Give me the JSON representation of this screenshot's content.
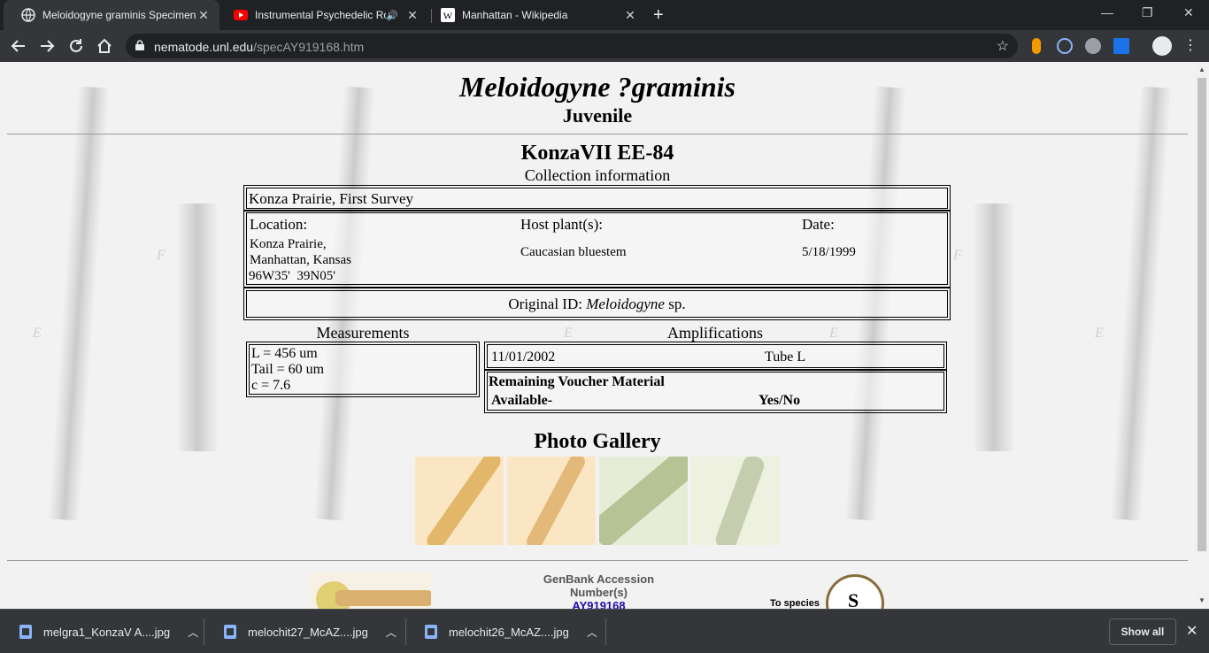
{
  "browser": {
    "tabs": [
      {
        "title": "Meloidogyne graminis Specimen",
        "active": true,
        "icon": "globe-icon"
      },
      {
        "title": "Instrumental Psychedelic Ro",
        "active": false,
        "icon": "youtube-icon",
        "audio": true
      },
      {
        "title": "Manhattan - Wikipedia",
        "active": false,
        "icon": "wikipedia-icon"
      }
    ],
    "new_tab": "+",
    "window_controls": [
      "—",
      "❐",
      "✕"
    ],
    "url_host": "nematode.unl.edu",
    "url_path": "/specAY919168.htm"
  },
  "page": {
    "species": "Meloidogyne ?graminis",
    "stage": "Juvenile",
    "specimen": "KonzaVII EE-84",
    "collection_heading": "Collection information",
    "survey": "Konza Prairie, First Survey",
    "location_label": "Location:",
    "location_lines": [
      "Konza Prairie,",
      "Manhattan, Kansas",
      "96W35'  39N05'"
    ],
    "host_label": "Host plant(s):",
    "host": "Caucasian bluestem",
    "date_label": "Date:",
    "date": "5/18/1999",
    "original_id_prefix": "Original ID: ",
    "original_id_genus": "Meloidogyne",
    "original_id_suffix": " sp.",
    "measurements_heading": "Measurements",
    "measurements": [
      "L = 456 um",
      "Tail = 60 um",
      "c = 7.6"
    ],
    "amplifications_heading": "Amplifications",
    "amp_date": "11/01/2002",
    "amp_tube": "Tube L",
    "voucher_label": "Remaining Voucher Material",
    "available_label": "Available-",
    "available_value": "Yes/No",
    "gallery_heading": "Photo Gallery",
    "genbank_label": "GenBank Accession Number(s)",
    "genbank_accession": "AY919168",
    "to_species": "To species",
    "bg_letters": [
      "F",
      "E",
      "F",
      "E",
      "E",
      "F",
      "E"
    ]
  },
  "downloads": {
    "items": [
      "melgra1_KonzaV A....jpg",
      "melochit27_McAZ....jpg",
      "melochit26_McAZ....jpg"
    ],
    "show_all": "Show all",
    "close": "✕"
  }
}
